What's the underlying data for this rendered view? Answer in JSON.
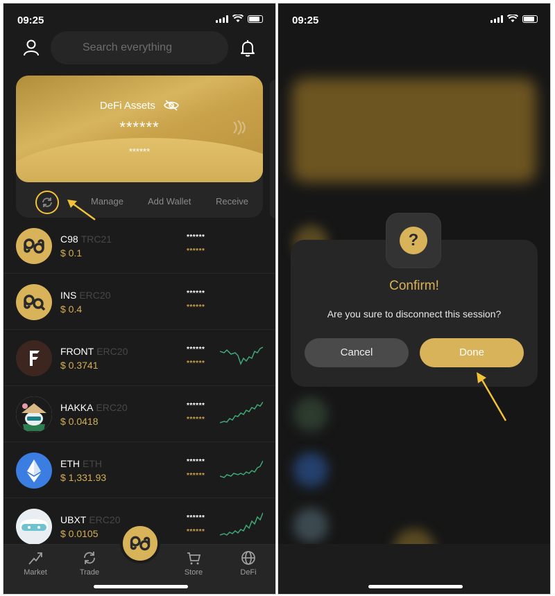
{
  "status": {
    "time": "09:25"
  },
  "search": {
    "placeholder": "Search everything"
  },
  "card": {
    "title": "DeFi Assets",
    "balance": "******",
    "sub_balance": "******"
  },
  "actions": {
    "manage": "Manage",
    "add_wallet": "Add Wallet",
    "receive": "Receive"
  },
  "tokens": [
    {
      "symbol": "C98",
      "standard": "TRC21",
      "price": "$ 0.1",
      "bal1": "******",
      "bal2": "******"
    },
    {
      "symbol": "INS",
      "standard": "ERC20",
      "price": "$ 0.4",
      "bal1": "******",
      "bal2": "******"
    },
    {
      "symbol": "FRONT",
      "standard": "ERC20",
      "price": "$ 0.3741",
      "bal1": "******",
      "bal2": "******"
    },
    {
      "symbol": "HAKKA",
      "standard": "ERC20",
      "price": "$ 0.0418",
      "bal1": "******",
      "bal2": "******"
    },
    {
      "symbol": "ETH",
      "standard": "ETH",
      "price": "$ 1,331.93",
      "bal1": "******",
      "bal2": "******"
    },
    {
      "symbol": "UBXT",
      "standard": "ERC20",
      "price": "$ 0.0105",
      "bal1": "******",
      "bal2": "******"
    }
  ],
  "nav": {
    "market": "Market",
    "trade": "Trade",
    "store": "Store",
    "defi": "DeFi"
  },
  "dialog": {
    "icon": "?",
    "title": "Confirm!",
    "message": "Are you sure to disconnect this session?",
    "cancel": "Cancel",
    "done": "Done"
  },
  "colors": {
    "accent": "#d9b35a",
    "background": "#1b1b1b",
    "surface": "#262626",
    "sparkline": "#3fa877",
    "highlight": "#f2c23a"
  }
}
